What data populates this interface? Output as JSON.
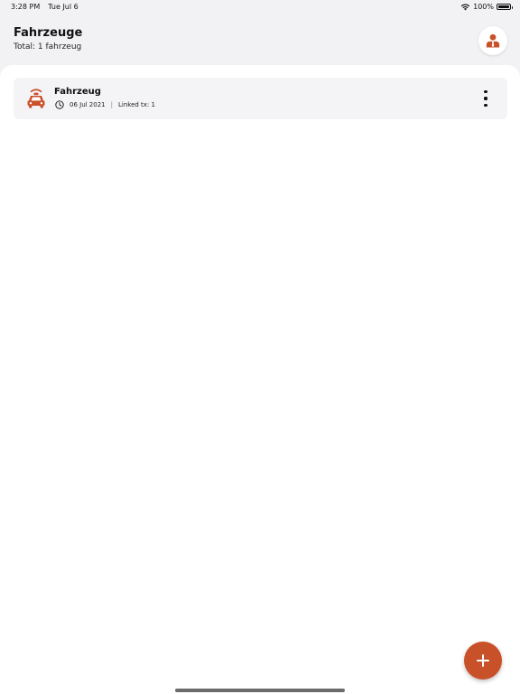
{
  "status_bar": {
    "time": "3:28 PM",
    "date": "Tue Jul 6",
    "battery": "100%",
    "icons": [
      "wifi-icon",
      "battery-icon"
    ]
  },
  "header": {
    "title": "Fahrzeuge",
    "subtitle": "Total: 1 fahrzeug",
    "profile_icon": "person-icon"
  },
  "vehicles": [
    {
      "name": "Fahrzeug",
      "date": "06 Jul 2021",
      "separator": "|",
      "linked": "Linked tx: 1",
      "icon": "car-icon",
      "time_icon": "clock-icon",
      "menu_icon": "more-vertical-icon"
    }
  ],
  "fab": {
    "icon": "plus-icon"
  },
  "colors": {
    "accent": "#c9512a",
    "background": "#f2f2f4",
    "card": "#f4f4f6",
    "sheet": "#ffffff"
  }
}
